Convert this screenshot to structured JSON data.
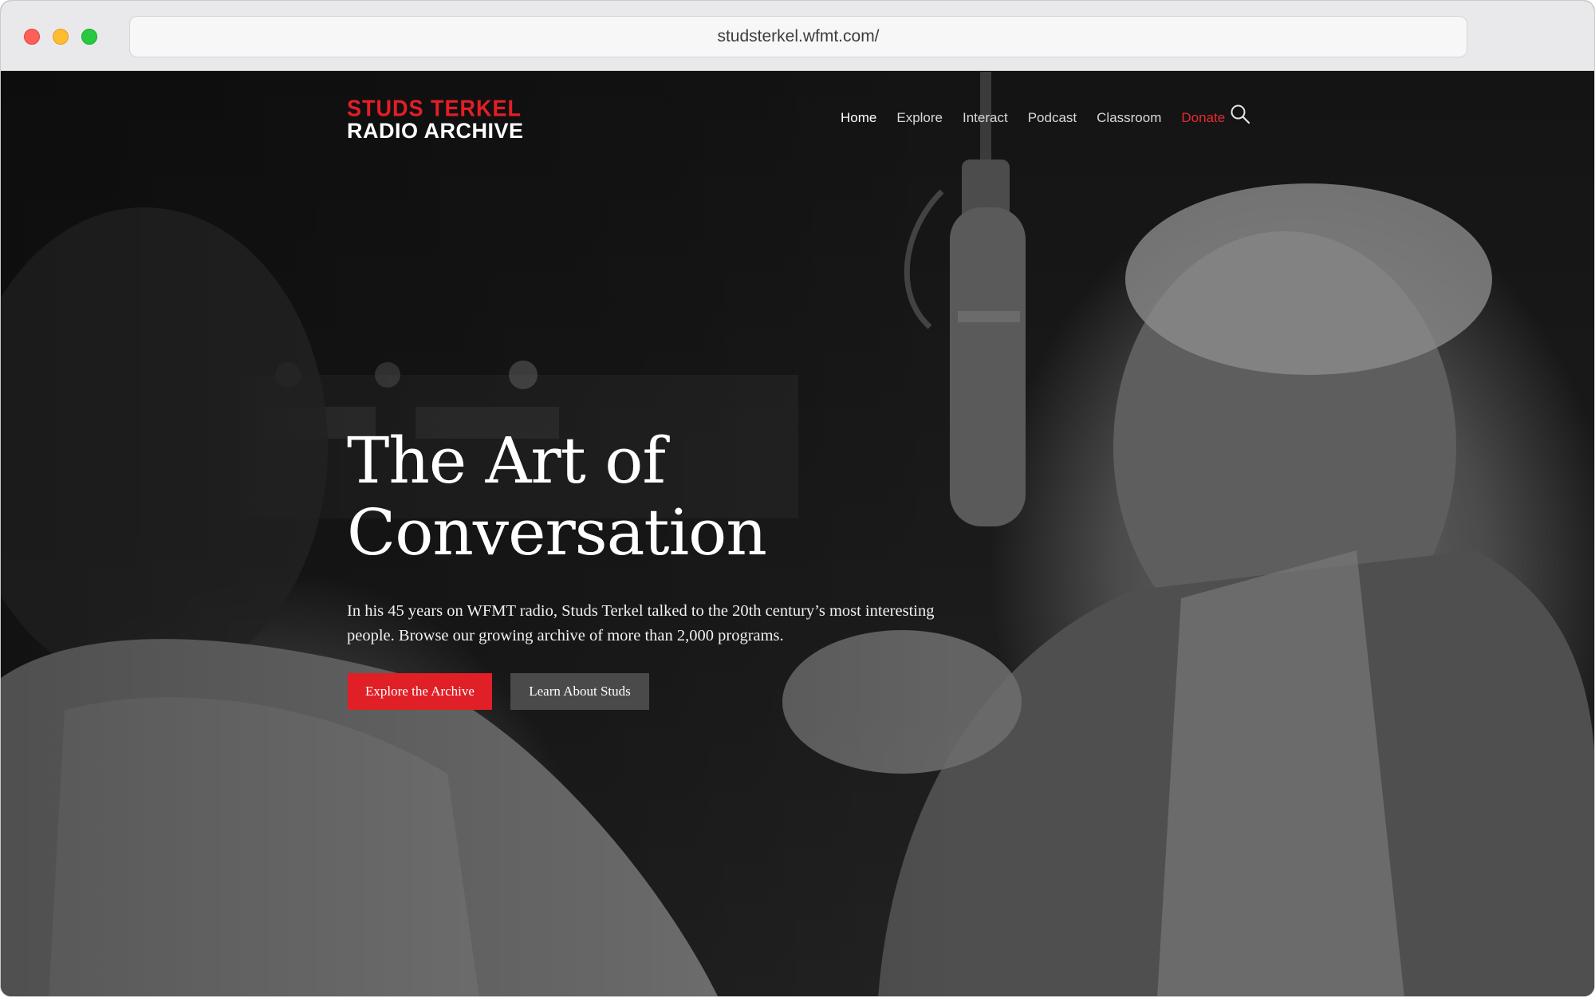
{
  "browser": {
    "url": "studsterkel.wfmt.com/"
  },
  "logo": {
    "line1": "STUDS TERKEL",
    "line2": "RADIO ARCHIVE"
  },
  "nav": {
    "items": [
      {
        "label": "Home"
      },
      {
        "label": "Explore"
      },
      {
        "label": "Interact"
      },
      {
        "label": "Podcast"
      },
      {
        "label": "Classroom"
      },
      {
        "label": "Donate"
      }
    ]
  },
  "hero": {
    "title_line1": "The Art of",
    "title_line2": "Conversation",
    "intro": "In his 45 years on WFMT radio, Studs Terkel talked to the 20th century’s most interesting people. Browse our growing archive of more than 2,000 programs.",
    "primary_button": "Explore the Archive",
    "secondary_button": "Learn About Studs"
  },
  "colors": {
    "brand_red": "#e31e26",
    "button_gray": "#4a4a4a"
  },
  "icons": {
    "search": "search-icon"
  }
}
